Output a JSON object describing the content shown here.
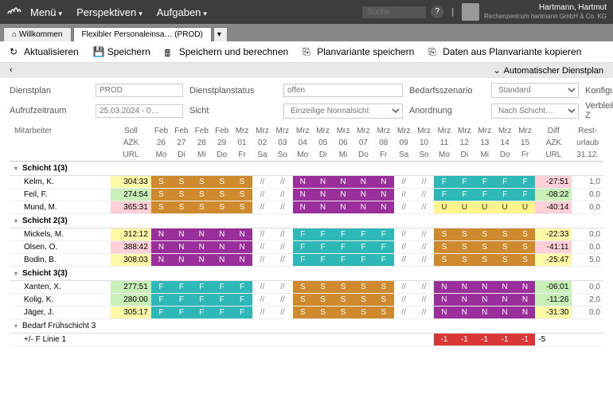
{
  "topbar": {
    "menu": [
      "Menü",
      "Perspektiven",
      "Aufgaben"
    ],
    "search_placeholder": "Suche",
    "help": "?",
    "user_name": "Hartmann, Hartmut",
    "user_org": "Rechenzentrum hartmann GmbH & Co. KG"
  },
  "tabs": [
    {
      "label": "Willkommen",
      "active": false
    },
    {
      "label": "Flexibler Personaleinsa… (PROD)",
      "active": true
    }
  ],
  "toolbar": [
    {
      "icon": "↻",
      "label": "Aktualisieren"
    },
    {
      "icon": "💾",
      "label": "Speichern"
    },
    {
      "icon": "🖩",
      "label": "Speichern und berechnen"
    },
    {
      "icon": "⎘",
      "label": "Planvariante speichern"
    },
    {
      "icon": "⎘",
      "label": "Daten aus Planvariante kopieren"
    }
  ],
  "subbar": {
    "left": "",
    "right": "Automatischer Dienstplan"
  },
  "filters": {
    "dienstplan_lbl": "Dienstplan",
    "dienstplan_val": "PROD",
    "status_lbl": "Dienstplanstatus",
    "status_val": "offen",
    "szenario_lbl": "Bedarfsszenario",
    "szenario_val": "Standard",
    "konfig_lbl": "Konfiguration",
    "aufruf_lbl": "Aufrufzeitraum",
    "aufruf_val": "25.03.2024 - 0…",
    "sicht_lbl": "Sicht",
    "sicht_val": "Einzeilige Normalsicht",
    "anordnung_lbl": "Anordnung",
    "anordnung_val": "Nach Schicht…",
    "verbleib_lbl": "Verbleibende Z"
  },
  "header": {
    "emp": "Mitarbeiter",
    "soll": [
      "Soll",
      "AZK",
      "URL"
    ],
    "days": [
      {
        "m": "Feb",
        "d": "26",
        "w": "Mo"
      },
      {
        "m": "Feb",
        "d": "27",
        "w": "Di"
      },
      {
        "m": "Feb",
        "d": "28",
        "w": "Mi"
      },
      {
        "m": "Feb",
        "d": "29",
        "w": "Do"
      },
      {
        "m": "Mrz",
        "d": "01",
        "w": "Fr"
      },
      {
        "m": "Mrz",
        "d": "02",
        "w": "Sa"
      },
      {
        "m": "Mrz",
        "d": "03",
        "w": "So"
      },
      {
        "m": "Mrz",
        "d": "04",
        "w": "Mo"
      },
      {
        "m": "Mrz",
        "d": "05",
        "w": "Di"
      },
      {
        "m": "Mrz",
        "d": "06",
        "w": "Mi"
      },
      {
        "m": "Mrz",
        "d": "07",
        "w": "Do"
      },
      {
        "m": "Mrz",
        "d": "08",
        "w": "Fr"
      },
      {
        "m": "Mrz",
        "d": "09",
        "w": "Sa"
      },
      {
        "m": "Mrz",
        "d": "10",
        "w": "So"
      },
      {
        "m": "Mrz",
        "d": "11",
        "w": "Mo"
      },
      {
        "m": "Mrz",
        "d": "12",
        "w": "Di"
      },
      {
        "m": "Mrz",
        "d": "13",
        "w": "Mi"
      },
      {
        "m": "Mrz",
        "d": "14",
        "w": "Do"
      },
      {
        "m": "Mrz",
        "d": "15",
        "w": "Fr"
      }
    ],
    "diff": [
      "Diff",
      "AZK",
      "URL"
    ],
    "rest": [
      "Rest-",
      "urlaub",
      "31.12."
    ]
  },
  "groups": [
    {
      "name": "Schicht 1(3)",
      "rows": [
        {
          "name": "Kelm, K.",
          "soll": "304:33",
          "sollbg": "bg-y",
          "cells": [
            "S",
            "S",
            "S",
            "S",
            "S",
            "//",
            "//",
            "N",
            "N",
            "N",
            "N",
            "N",
            "//",
            "//",
            "F",
            "F",
            "F",
            "F",
            "F"
          ],
          "diff": "-27:51",
          "diffbg": "bg-p",
          "rest": "1,0"
        },
        {
          "name": "Feil, F.",
          "soll": "274:54",
          "sollbg": "bg-g",
          "cells": [
            "S",
            "S",
            "S",
            "S",
            "S",
            "//",
            "//",
            "N",
            "N",
            "N",
            "N",
            "N",
            "//",
            "//",
            "F",
            "F",
            "F",
            "F",
            "F"
          ],
          "diff": "-08:22",
          "diffbg": "bg-g",
          "rest": "0,0"
        },
        {
          "name": "Mund, M.",
          "soll": "365:31",
          "sollbg": "bg-p",
          "cells": [
            "S",
            "S",
            "S",
            "S",
            "S",
            "//",
            "//",
            "N",
            "N",
            "N",
            "N",
            "N",
            "//",
            "//",
            "U",
            "U",
            "U",
            "U",
            "U"
          ],
          "diff": "-40:14",
          "diffbg": "bg-p",
          "rest": "0,0"
        }
      ]
    },
    {
      "name": "Schicht 2(3)",
      "rows": [
        {
          "name": "Mickels, M.",
          "soll": "312:12",
          "sollbg": "bg-y",
          "cells": [
            "N",
            "N",
            "N",
            "N",
            "N",
            "//",
            "//",
            "F",
            "F",
            "F",
            "F",
            "F",
            "//",
            "//",
            "S",
            "S",
            "S",
            "S",
            "S"
          ],
          "diff": "-22:33",
          "diffbg": "bg-y",
          "rest": "0,0"
        },
        {
          "name": "Olsen, O.",
          "soll": "388:42",
          "sollbg": "bg-p",
          "cells": [
            "N",
            "N",
            "N",
            "N",
            "N",
            "//",
            "//",
            "F",
            "F",
            "F",
            "F",
            "F",
            "//",
            "//",
            "S",
            "S",
            "S",
            "S",
            "S"
          ],
          "diff": "-41:11",
          "diffbg": "bg-p",
          "rest": "0,0"
        },
        {
          "name": "Bodin, B.",
          "soll": "308:03",
          "sollbg": "bg-y",
          "cells": [
            "N",
            "N",
            "N",
            "N",
            "N",
            "//",
            "//",
            "F",
            "F",
            "F",
            "F",
            "F",
            "//",
            "//",
            "S",
            "S",
            "S",
            "S",
            "S"
          ],
          "diff": "-25:47",
          "diffbg": "bg-y",
          "rest": "5,0"
        }
      ]
    },
    {
      "name": "Schicht 3(3)",
      "rows": [
        {
          "name": "Xanten, X.",
          "soll": "277:51",
          "sollbg": "bg-g",
          "cells": [
            "F",
            "F",
            "F",
            "F",
            "F",
            "//",
            "//",
            "S",
            "S",
            "S",
            "S",
            "S",
            "//",
            "//",
            "N",
            "N",
            "N",
            "N",
            "N"
          ],
          "diff": "-06:01",
          "diffbg": "bg-g",
          "rest": "0,0"
        },
        {
          "name": "Kolig, K.",
          "soll": "280:00",
          "sollbg": "bg-g",
          "cells": [
            "F",
            "F",
            "F",
            "F",
            "F",
            "//",
            "//",
            "S",
            "S",
            "S",
            "S",
            "S",
            "//",
            "//",
            "N",
            "N",
            "N",
            "N",
            "N"
          ],
          "diff": "-11:26",
          "diffbg": "bg-g",
          "rest": "2,0"
        },
        {
          "name": "Jäger, J.",
          "soll": "305:17",
          "sollbg": "bg-y",
          "cells": [
            "F",
            "F",
            "F",
            "F",
            "F",
            "//",
            "//",
            "S",
            "S",
            "S",
            "S",
            "S",
            "//",
            "//",
            "N",
            "N",
            "N",
            "N",
            "N"
          ],
          "diff": "-31:30",
          "diffbg": "bg-y",
          "rest": "0,0"
        }
      ]
    }
  ],
  "bedarf": {
    "label": "Bedarf Frühschicht 3",
    "row_label": "+/- F Linie 1",
    "cells": [
      "",
      "",
      "",
      "",
      "",
      "",
      "",
      "",
      "",
      "",
      "",
      "",
      "",
      "",
      "-1",
      "-1",
      "-1",
      "-1",
      "-1"
    ],
    "diff": "-5"
  }
}
